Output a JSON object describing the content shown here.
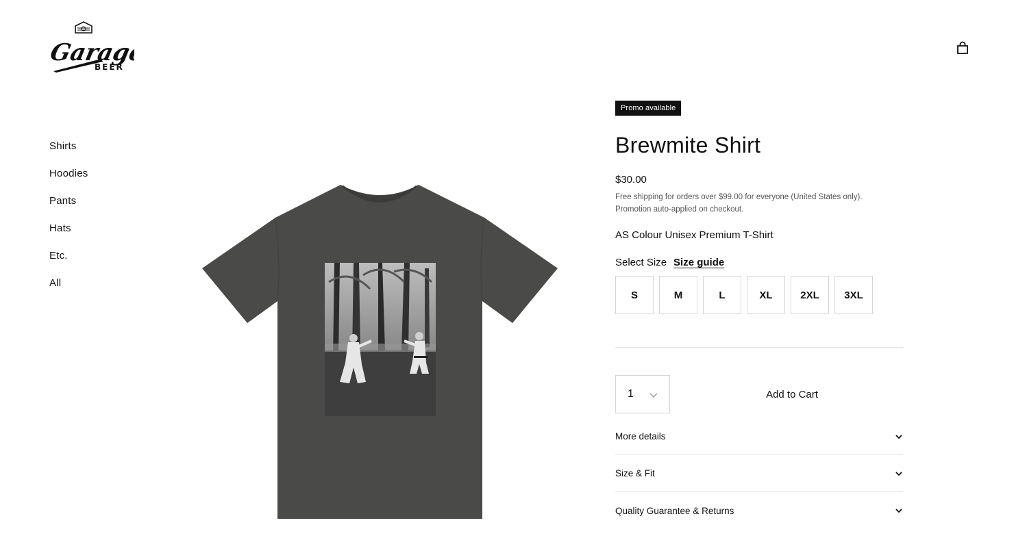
{
  "brand": {
    "logo_word": "Garage",
    "logo_sub": "BEER"
  },
  "header": {
    "cart_icon": "shopping-bag-icon"
  },
  "nav": {
    "items": [
      {
        "label": "Shirts"
      },
      {
        "label": "Hoodies"
      },
      {
        "label": "Pants"
      },
      {
        "label": "Hats"
      },
      {
        "label": "Etc."
      },
      {
        "label": "All"
      }
    ]
  },
  "product": {
    "badge": "Promo available",
    "title": "Brewmite Shirt",
    "price": "$30.00",
    "shipping_line1": "Free shipping for orders over $99.00 for everyone (United States only).",
    "shipping_line2": "Promotion auto-applied on checkout.",
    "variant_name": "AS Colour Unisex Premium T-Shirt",
    "select_size_label": "Select Size",
    "size_guide_label": "Size guide",
    "sizes": [
      "S",
      "M",
      "L",
      "XL",
      "2XL",
      "3XL"
    ],
    "quantity": "1",
    "add_to_cart_label": "Add to Cart",
    "image_icon": "t-shirt-image",
    "accordion": [
      {
        "label": "More details"
      },
      {
        "label": "Size & Fit"
      },
      {
        "label": "Quality Guarantee & Returns"
      }
    ]
  },
  "colors": {
    "shirt": "#4a4b48",
    "accent": "#111111",
    "border": "#d6d6d6"
  }
}
